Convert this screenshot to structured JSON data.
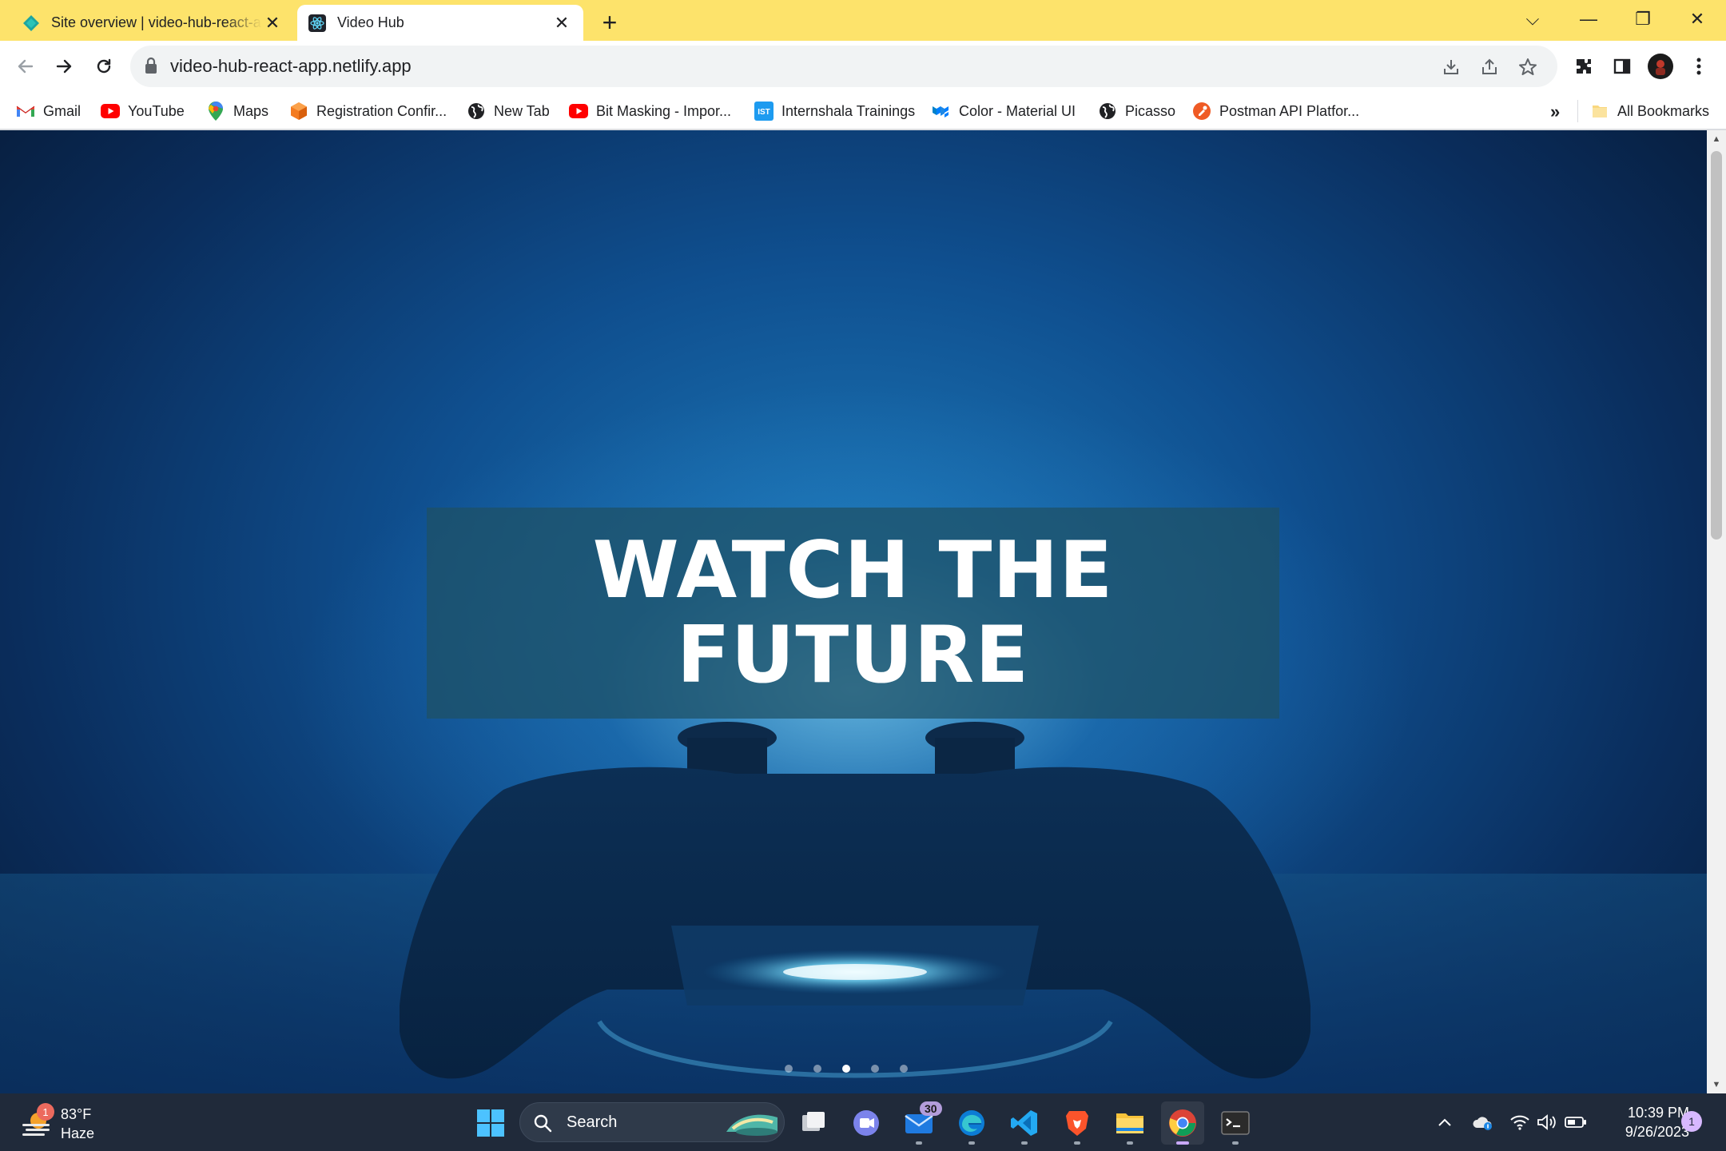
{
  "browser": {
    "tabs": [
      {
        "title": "Site overview | video-hub-react-app",
        "active": false,
        "close": "✕"
      },
      {
        "title": "Video Hub",
        "active": true,
        "close": "✕"
      }
    ],
    "new_tab_glyph": "+",
    "window_controls": {
      "tab_search": "⌵",
      "minimize": "—",
      "restore": "❐",
      "close": "✕"
    },
    "address": {
      "url": "video-hub-react-app.netlify.app"
    },
    "bookmarks": [
      {
        "label": "Gmail",
        "icon": "gmail-icon"
      },
      {
        "label": "YouTube",
        "icon": "youtube-icon"
      },
      {
        "label": "Maps",
        "icon": "maps-icon"
      },
      {
        "label": "Registration Confir...",
        "icon": "cube-icon"
      },
      {
        "label": "New Tab",
        "icon": "globe-icon"
      },
      {
        "label": "Bit Masking - Impor...",
        "icon": "youtube-icon"
      },
      {
        "label": "Internshala Trainings",
        "icon": "ist-icon"
      },
      {
        "label": "Color - Material UI",
        "icon": "mui-icon"
      },
      {
        "label": "Picasso",
        "icon": "globe-icon"
      },
      {
        "label": "Postman API Platfor...",
        "icon": "postman-icon"
      }
    ],
    "bookmarks_more": "»",
    "all_bookmarks": "All Bookmarks",
    "accent_color": "#fde36b"
  },
  "page": {
    "hero_caption": "WATCH THE\nFUTURE",
    "carousel": {
      "slide_count": 5,
      "active_index": 2
    }
  },
  "taskbar": {
    "weather": {
      "temp": "83°F",
      "condition": "Haze",
      "badge": "1"
    },
    "search_label": "Search",
    "mail_badge": "30",
    "clock": {
      "time": "10:39 PM",
      "date": "9/26/2023"
    },
    "notification_count": "1"
  }
}
